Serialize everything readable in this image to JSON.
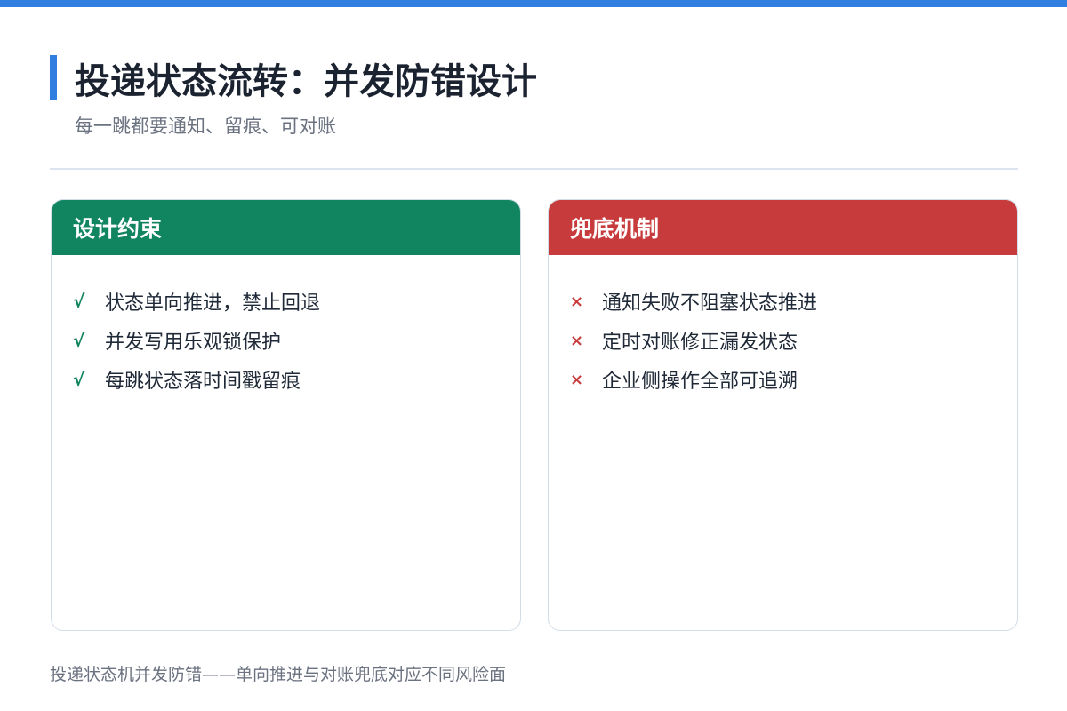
{
  "header": {
    "title": "投递状态流转：并发防错设计",
    "subtitle": "每一跳都要通知、留痕、可对账"
  },
  "colors": {
    "accent": "#2f7ee0",
    "constraints": "#108560",
    "fallback": "#c83b3d"
  },
  "constraints_card": {
    "title": "设计约束",
    "marker": "√",
    "items": [
      "状态单向推进，禁止回退",
      "并发写用乐观锁保护",
      "每跳状态落时间戳留痕"
    ]
  },
  "fallback_card": {
    "title": "兜底机制",
    "marker": "×",
    "items": [
      "通知失败不阻塞状态推进",
      "定时对账修正漏发状态",
      "企业侧操作全部可追溯"
    ]
  },
  "footer": {
    "caption": "投递状态机并发防错——单向推进与对账兜底对应不同风险面"
  }
}
